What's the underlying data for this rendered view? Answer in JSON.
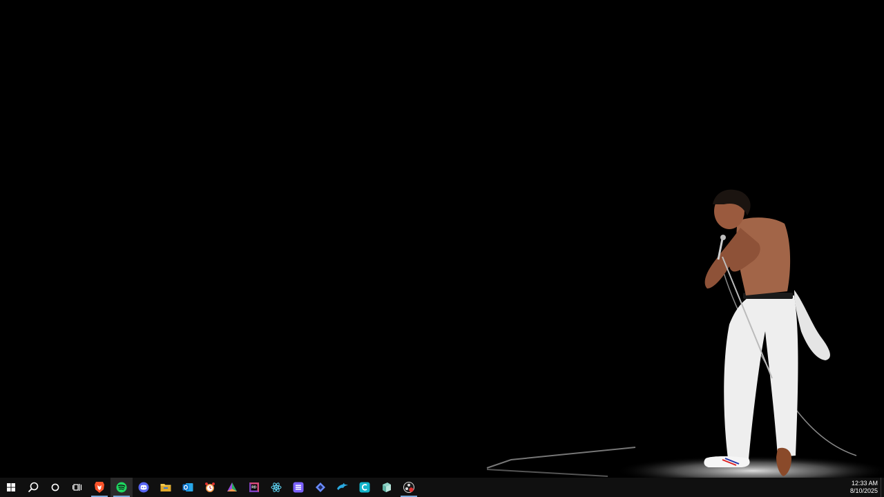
{
  "taskbar": {
    "system_buttons": [
      {
        "name": "start-button",
        "icon": "windows-logo-icon",
        "color": "#ffffff"
      },
      {
        "name": "search-button",
        "icon": "search-icon",
        "color": "#ffffff"
      },
      {
        "name": "cortana-button",
        "icon": "cortana-circle-icon",
        "color": "#ffffff"
      },
      {
        "name": "task-view-button",
        "icon": "task-view-icon",
        "color": "#ffffff"
      }
    ],
    "apps": [
      {
        "name": "brave",
        "icon": "brave-lion-icon",
        "color": "#fb542b",
        "running": true,
        "active": false
      },
      {
        "name": "spotify",
        "icon": "spotify-icon",
        "color": "#1ed760",
        "running": true,
        "active": true
      },
      {
        "name": "discord",
        "icon": "discord-icon",
        "color": "#5865f2",
        "running": false,
        "active": false
      },
      {
        "name": "file-explorer",
        "icon": "folder-icon",
        "color": "#f2c94c",
        "running": false,
        "active": false
      },
      {
        "name": "outlook",
        "icon": "outlook-icon",
        "color": "#0a74d1",
        "running": false,
        "active": false
      },
      {
        "name": "alarm-clock",
        "icon": "alarm-clock-icon",
        "color": "#f2994a",
        "running": false,
        "active": false
      },
      {
        "name": "prism",
        "icon": "triangle-prism-icon",
        "color": "#9b51e0",
        "running": false,
        "active": false
      },
      {
        "name": "rider",
        "icon": "rider-icon",
        "color": "#d64a7a",
        "running": false,
        "active": false
      },
      {
        "name": "react-devtools",
        "icon": "atom-icon",
        "color": "#61dafb",
        "running": false,
        "active": false
      },
      {
        "name": "notes-app",
        "icon": "lines-app-icon",
        "color": "#7b61ff",
        "running": false,
        "active": false
      },
      {
        "name": "diamond-app",
        "icon": "diamond-icon",
        "color": "#6a8cff",
        "running": false,
        "active": false
      },
      {
        "name": "dolphin-emulator",
        "icon": "dolphin-icon",
        "color": "#2aa9e0",
        "running": false,
        "active": false
      },
      {
        "name": "c-app",
        "icon": "c-letter-icon",
        "color": "#12b5cb",
        "running": false,
        "active": false
      },
      {
        "name": "glass-app",
        "icon": "glass-cube-icon",
        "color": "#8fd3c6",
        "running": false,
        "active": false
      },
      {
        "name": "obs-studio",
        "icon": "obs-icon",
        "color": "#e03131",
        "running": true,
        "active": false
      }
    ],
    "clock": {
      "time": "12:33 AM",
      "date": "8/10/2025"
    }
  }
}
